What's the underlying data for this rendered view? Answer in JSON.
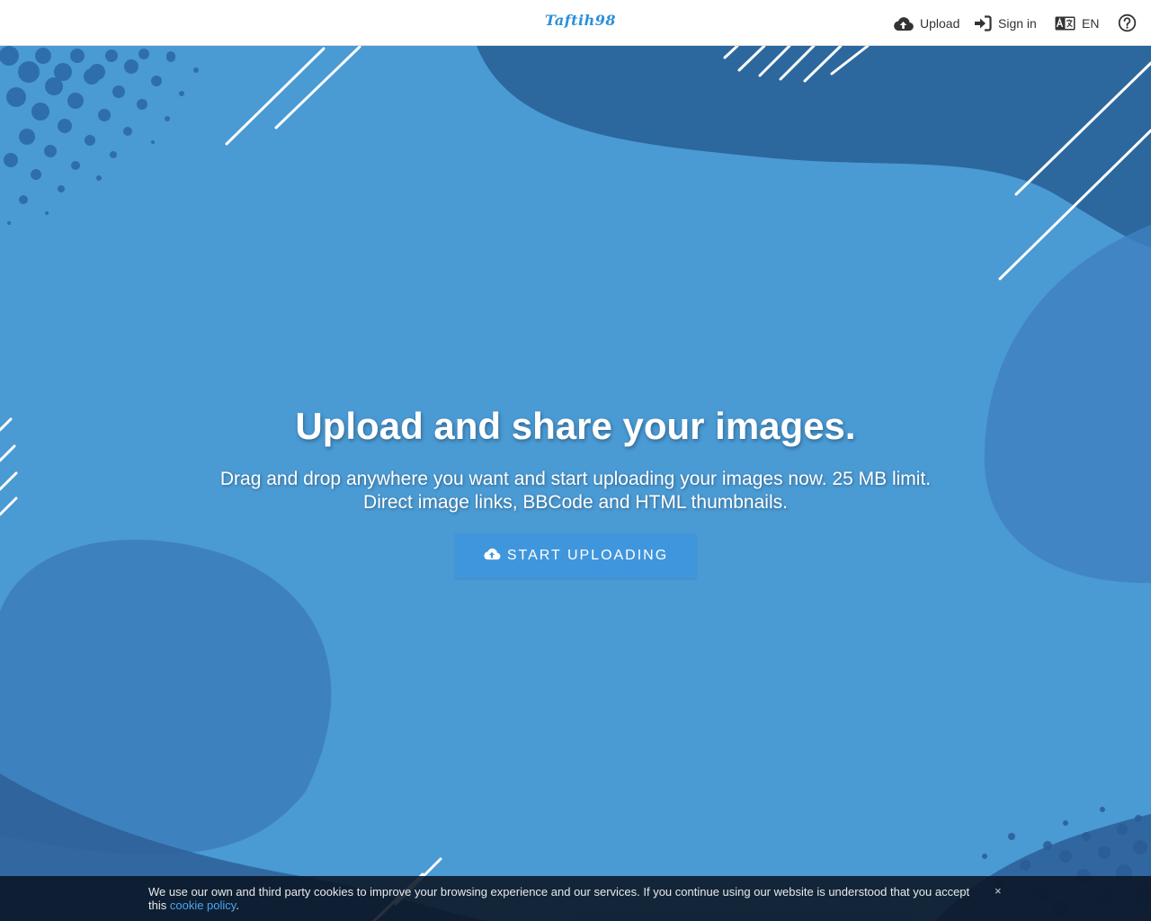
{
  "header": {
    "logo_text": "Taftih98",
    "nav": {
      "upload_label": "Upload",
      "signin_label": "Sign in",
      "language_label": "EN"
    }
  },
  "hero": {
    "title": "Upload and share your images.",
    "subtitle": "Drag and drop anywhere you want and start uploading your images now. 25 MB limit. Direct image links, BBCode and HTML thumbnails.",
    "cta_label": "START UPLOADING"
  },
  "cookie_notice": {
    "text": "We use our own and third party cookies to improve your browsing experience and our services. If you continue using our website is understood that you accept this",
    "link_label": "cookie policy",
    "suffix": ".",
    "close_label": "×"
  },
  "icons": {
    "upload": "cloud-upload-icon",
    "signin": "sign-in-icon",
    "language": "language-icon",
    "help": "help-circle-icon"
  },
  "colors": {
    "background": "#4a9ad4",
    "accent": "#3f96dc",
    "logo": "#2b90d9",
    "header_bg": "#ffffff",
    "cookie_bg": "#0a1423"
  }
}
